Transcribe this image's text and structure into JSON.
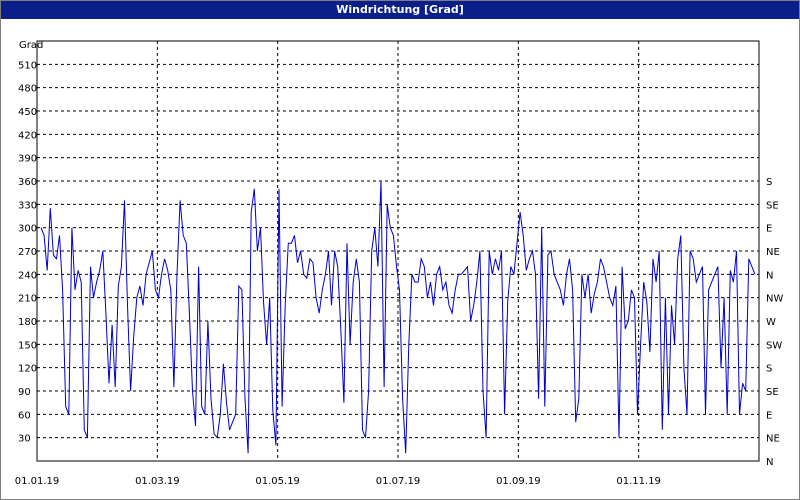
{
  "window": {
    "title": "Windrichtung [Grad]"
  },
  "chart_data": {
    "type": "line",
    "title": "Windrichtung [Grad]",
    "ylabel": "Grad",
    "xlabel": "",
    "ylim": [
      0,
      540
    ],
    "xlim": [
      "01.01.19",
      "31.12.19"
    ],
    "grid": true,
    "y_ticks": [
      30,
      60,
      90,
      120,
      150,
      180,
      210,
      240,
      270,
      300,
      330,
      360,
      390,
      420,
      450,
      480,
      510
    ],
    "x_tick_labels": [
      "01.01.19",
      "01.03.19",
      "01.05.19",
      "01.07.19",
      "01.09.19",
      "01.11.19"
    ],
    "right_axis_labels": [
      "N",
      "NE",
      "E",
      "SE",
      "S",
      "SW",
      "W",
      "NW",
      "N",
      "NE",
      "E",
      "SE",
      "S"
    ],
    "series_color": "#0000cc",
    "series": [
      {
        "values": [
          300,
          290,
          245,
          325,
          265,
          260,
          290,
          220,
          70,
          60,
          300,
          220,
          245,
          230,
          40,
          30,
          250,
          210,
          230,
          245,
          270,
          190,
          100,
          175,
          95,
          225,
          250,
          335,
          200,
          90,
          160,
          210,
          225,
          200,
          240,
          255,
          270,
          220,
          210,
          240,
          260,
          245,
          220,
          95,
          240,
          335,
          290,
          280,
          190,
          90,
          45,
          250,
          70,
          60,
          180,
          80,
          35,
          30,
          60,
          125,
          75,
          40,
          50,
          60,
          225,
          220,
          80,
          10,
          320,
          350,
          270,
          300,
          205,
          150,
          210,
          65,
          20,
          350,
          70,
          200,
          280,
          280,
          290,
          255,
          270,
          240,
          235,
          260,
          255,
          210,
          190,
          220,
          240,
          270,
          200,
          270,
          250,
          170,
          75,
          280,
          150,
          230,
          260,
          230,
          40,
          30,
          90,
          270,
          300,
          250,
          360,
          95,
          330,
          300,
          290,
          250,
          220,
          80,
          10,
          150,
          240,
          230,
          230,
          260,
          250,
          210,
          230,
          200,
          240,
          250,
          220,
          230,
          200,
          190,
          220,
          240,
          240,
          245,
          250,
          180,
          200,
          230,
          270,
          90,
          30,
          270,
          240,
          260,
          245,
          270,
          60,
          205,
          250,
          240,
          280,
          320,
          290,
          245,
          260,
          270,
          240,
          80,
          300,
          70,
          265,
          270,
          240,
          230,
          220,
          200,
          240,
          260,
          220,
          50,
          80,
          240,
          210,
          240,
          190,
          215,
          230,
          260,
          250,
          230,
          210,
          200,
          225,
          30,
          250,
          170,
          180,
          220,
          210,
          60,
          150,
          230,
          205,
          140,
          260,
          230,
          270,
          40,
          210,
          60,
          200,
          150,
          260,
          290,
          120,
          60,
          270,
          260,
          230,
          240,
          250,
          60,
          220,
          230,
          240,
          250,
          120,
          210,
          60,
          245,
          230,
          270,
          60,
          100,
          90,
          260,
          250,
          240
        ]
      }
    ]
  }
}
